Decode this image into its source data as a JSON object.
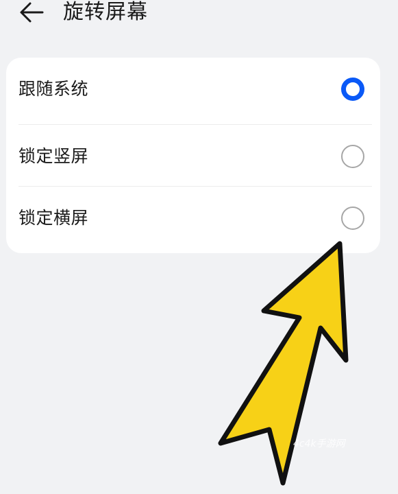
{
  "header": {
    "back_icon": "arrow-left-icon",
    "title": "旋转屏幕"
  },
  "options": [
    {
      "label": "跟随系统",
      "selected": true
    },
    {
      "label": "锁定竖屏",
      "selected": false
    },
    {
      "label": "锁定横屏",
      "selected": false
    }
  ],
  "colors": {
    "accent": "#0a59f7",
    "arrow_fill": "#f7d117",
    "background": "#f1f2f4"
  },
  "watermark": "4c4k手游网"
}
